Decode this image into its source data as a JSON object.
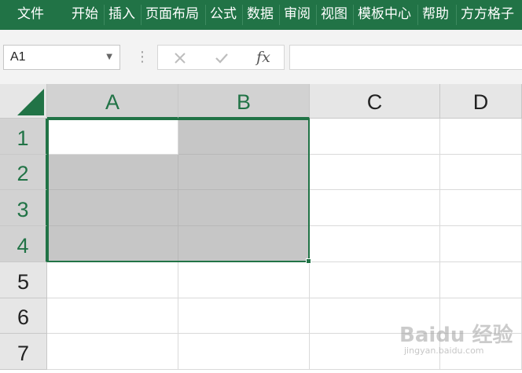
{
  "ribbon": {
    "tabs": [
      "文件",
      "开始",
      "插入",
      "页面布局",
      "公式",
      "数据",
      "审阅",
      "视图",
      "模板中心",
      "帮助",
      "方方格子"
    ]
  },
  "formula_bar": {
    "name_box": "A1",
    "name_box_dropdown_icon": "chevron-down-icon",
    "cancel_icon": "cancel-x-icon",
    "enter_icon": "checkmark-icon",
    "fx_label": "fx",
    "formula_value": ""
  },
  "grid": {
    "columns": [
      "A",
      "B",
      "C",
      "D"
    ],
    "rows": [
      "1",
      "2",
      "3",
      "4",
      "5",
      "6",
      "7"
    ],
    "selected_range": "A1:B4",
    "active_cell": "A1"
  },
  "watermark": {
    "text": "Baidu 经验",
    "sub": "jingyan.baidu.com"
  },
  "colors": {
    "ribbon": "#217346",
    "selection_border": "#217346",
    "highlight_fill": "#c6c6c6"
  }
}
